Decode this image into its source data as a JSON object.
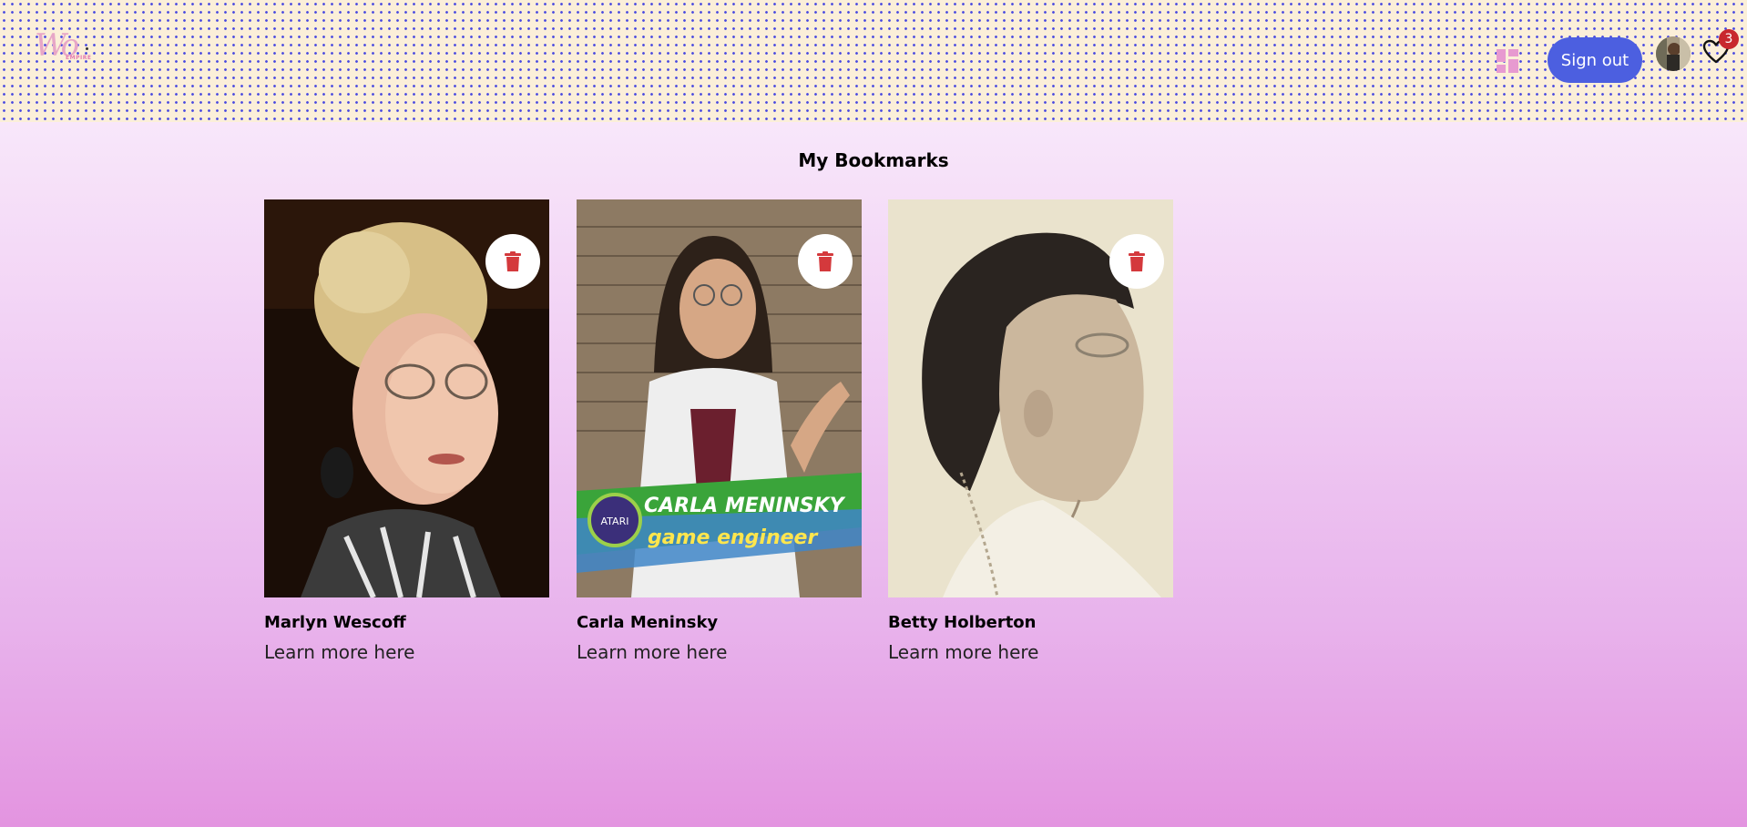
{
  "header": {
    "logo": {
      "script": "Wo",
      "sub": "EMPIRE"
    },
    "dashboard_icon": "dashboard-icon",
    "signout_label": "Sign out",
    "bookmark_count": "3",
    "colors": {
      "header_bg": "#fbefd9",
      "dots": "#4a4ae0",
      "button": "#4c5fe0",
      "badge": "#c8282e"
    }
  },
  "page": {
    "title": "My Bookmarks"
  },
  "bookmarks": [
    {
      "name": "Marlyn Wescoff",
      "link": "Learn more here",
      "delete_icon": "trash-icon"
    },
    {
      "name": "Carla Meninsky",
      "link": "Learn more here",
      "delete_icon": "trash-icon",
      "caption": {
        "line1": "CARLA MENINSKY",
        "line2": "game engineer",
        "logo": "ATARI"
      }
    },
    {
      "name": "Betty Holberton",
      "link": "Learn more here",
      "delete_icon": "trash-icon"
    }
  ]
}
